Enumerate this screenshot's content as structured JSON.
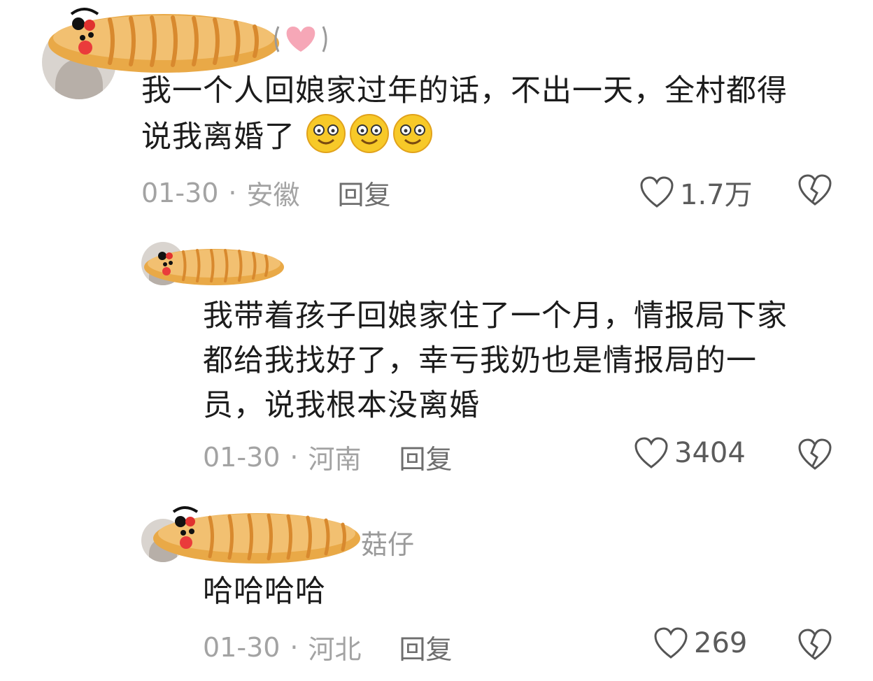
{
  "comments": [
    {
      "username_suffix": "",
      "text_line1": "我一个人回娘家过年的话，不出一天，全村都得",
      "text_line2": "说我离婚了",
      "date": "01-30",
      "location": "安徽",
      "reply_label": "回复",
      "likes": "1.7万",
      "emoji_count": 3
    },
    {
      "username_suffix": "",
      "text_line1": "我带着孩子回娘家住了一个月，情报局下家",
      "text_line2": "都给我找好了，幸亏我奶也是情报局的一",
      "text_line3": "员，说我根本没离婚",
      "date": "01-30",
      "location": "河南",
      "reply_label": "回复",
      "likes": "3404"
    },
    {
      "username_suffix": "菇仔",
      "text_line1": "哈哈哈哈",
      "date": "01-30",
      "location": "河北",
      "reply_label": "回复",
      "likes": "269"
    }
  ],
  "icons": {
    "like": "heart-outline-icon",
    "dislike": "broken-heart-icon",
    "emoji": "smiling-face-icon",
    "username_cover": "bread-sticker"
  },
  "colors": {
    "text": "#1c1c1c",
    "meta": "#a3a3a3",
    "bread": "#e9a947",
    "heart_badge": "#f6a7b7"
  }
}
